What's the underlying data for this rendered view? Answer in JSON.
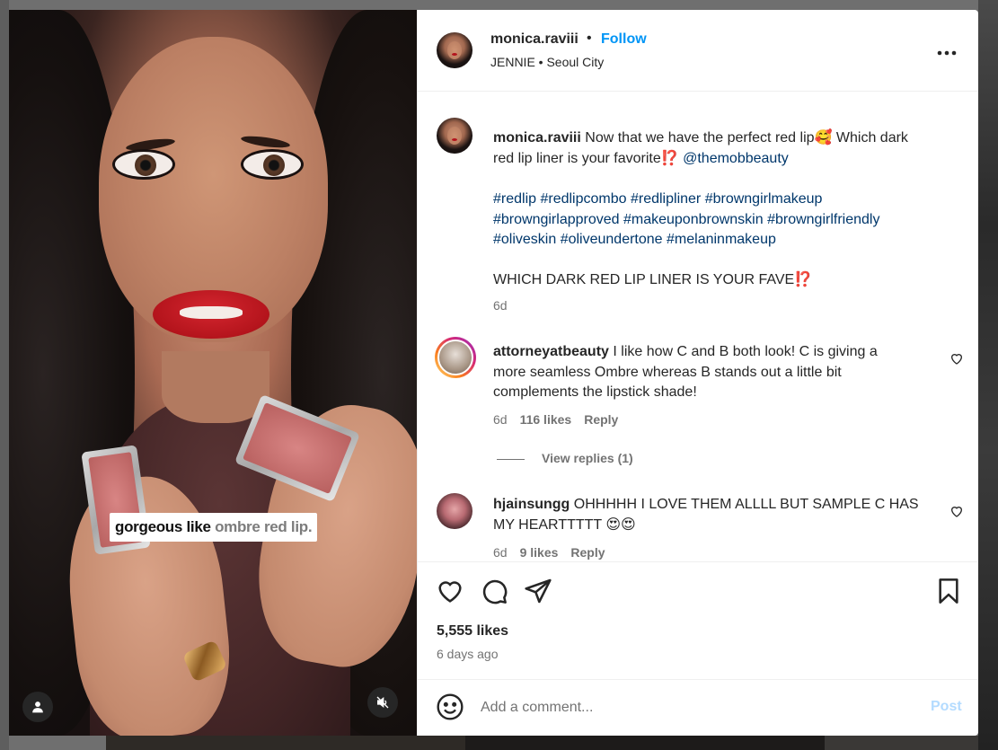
{
  "post": {
    "author": "monica.raviii",
    "separator": "•",
    "follow_label": "Follow",
    "subtitle": "JENNIE • Seoul City",
    "more_icon": "more-horizontal-icon",
    "media_caption_strong": "gorgeous like",
    "media_caption_soft": " ombre red lip."
  },
  "caption": {
    "author": "monica.raviii",
    "line1": " Now that we have the perfect red lip🥰 Which dark",
    "line2_text": "red lip liner is your favorite⁉️ ",
    "mention": "@themobbeauty",
    "hashtags_line1": "#redlip #redlipcombo #redlipliner #browngirlmakeup",
    "hashtags_line2": "#browngirlapproved #makeuponbrownskin #browngirlfriendly",
    "hashtags_line3": "#oliveskin #oliveundertone #melaninmakeup",
    "shout": "WHICH DARK RED LIP LINER IS YOUR FAVE⁉️",
    "time": "6d"
  },
  "comments": [
    {
      "author": "attorneyatbeauty",
      "line1": " I like how C and B both look! C is giving a",
      "line2": "more seamless Ombre whereas B stands out a little bit",
      "line3": "complements the lipstick shade!",
      "time": "6d",
      "likes": "116 likes",
      "reply": "Reply",
      "view_replies": "View replies (1)"
    },
    {
      "author": "hjainsungg",
      "line1": " OHHHHH I LOVE THEM ALLLL BUT SAMPLE C HAS",
      "line2": "MY HEARTTTTT 😍😍",
      "time": "6d",
      "likes": "9 likes",
      "reply": "Reply"
    }
  ],
  "actions": {
    "likes": "5,555 likes",
    "ago": "6 days ago"
  },
  "composer": {
    "placeholder": "Add a comment...",
    "post_label": "Post"
  },
  "colors": {
    "accent": "#0095f6",
    "link": "#00376b",
    "post_disabled": "#b3dbff",
    "text": "#262626",
    "muted": "#737373"
  }
}
